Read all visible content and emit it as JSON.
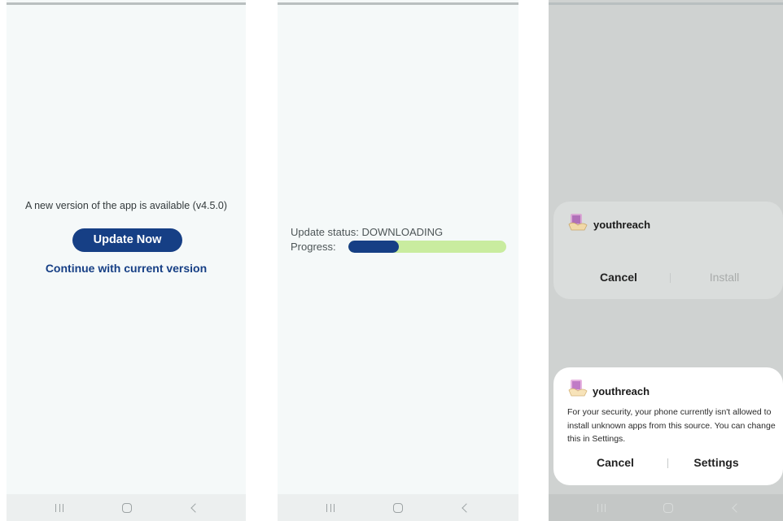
{
  "screen1": {
    "message": "A new version of the app is available (v4.5.0)",
    "update_button": "Update Now",
    "continue_link": "Continue with current version"
  },
  "screen2": {
    "status_text": "Update status: DOWNLOADING",
    "progress_label": "Progress:",
    "progress_fraction": 0.32,
    "colors": {
      "fill": "#163f85",
      "track": "#c9ec9f"
    }
  },
  "screen3": {
    "install_dialog": {
      "app_name": "youthreach",
      "cancel_label": "Cancel",
      "install_label": "Install"
    },
    "security_dialog": {
      "app_name": "youthreach",
      "message": "For your security, your phone currently isn't allowed to install unknown apps from this source. You can change this in Settings.",
      "cancel_label": "Cancel",
      "settings_label": "Settings"
    }
  },
  "nav_icons": [
    "recents-icon",
    "home-icon",
    "back-icon"
  ],
  "colors": {
    "accent": "#163f85",
    "screen_bg": "#f5f9f9",
    "overlay_bg": "#cfd2d1"
  }
}
